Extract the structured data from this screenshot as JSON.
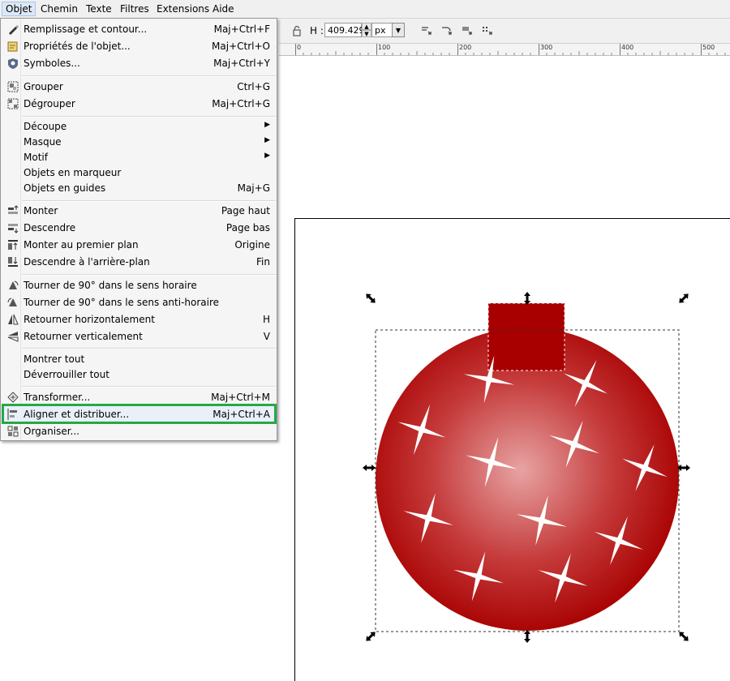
{
  "menubar": {
    "items": [
      {
        "label": "Objet",
        "active": true
      },
      {
        "label": "Chemin"
      },
      {
        "label": "Texte"
      },
      {
        "label": "Filtres"
      },
      {
        "label": "Extensions"
      },
      {
        "label": "Aide"
      }
    ]
  },
  "toolbar": {
    "h_label": "H :",
    "h_value": "409.429",
    "unit": "px",
    "spin_up": "▲",
    "spin_down": "▼",
    "dropdown_arrow": "▼"
  },
  "ruler": {
    "labels": [
      "0",
      "100",
      "200",
      "300",
      "400",
      "500"
    ]
  },
  "menu": {
    "items": [
      {
        "label": "Remplissage et contour...",
        "shortcut": "Maj+Ctrl+F",
        "icon": "fill-stroke-icon"
      },
      {
        "label": "Propriétés de l'objet...",
        "shortcut": "Maj+Ctrl+O",
        "icon": "object-properties-icon"
      },
      {
        "label": "Symboles...",
        "shortcut": "Maj+Ctrl+Y",
        "icon": "symbols-icon"
      },
      {
        "label": "Grouper",
        "shortcut": "Ctrl+G",
        "icon": "group-icon"
      },
      {
        "label": "Dégrouper",
        "shortcut": "Maj+Ctrl+G",
        "icon": "ungroup-icon"
      },
      {
        "label": "Découpe",
        "submenu": true
      },
      {
        "label": "Masque",
        "submenu": true
      },
      {
        "label": "Motif",
        "submenu": true
      },
      {
        "label": "Objets en marqueur"
      },
      {
        "label": "Objets en guides",
        "shortcut": "Maj+G"
      },
      {
        "label": "Monter",
        "shortcut": "Page haut",
        "icon": "raise-icon"
      },
      {
        "label": "Descendre",
        "shortcut": "Page bas",
        "icon": "lower-icon"
      },
      {
        "label": "Monter au premier plan",
        "shortcut": "Origine",
        "icon": "raise-to-top-icon"
      },
      {
        "label": "Descendre à l'arrière-plan",
        "shortcut": "Fin",
        "icon": "lower-to-bottom-icon"
      },
      {
        "label": "Tourner de 90° dans le sens horaire",
        "icon": "rotate-cw-icon"
      },
      {
        "label": "Tourner de 90° dans le sens anti-horaire",
        "icon": "rotate-ccw-icon"
      },
      {
        "label": "Retourner horizontalement",
        "shortcut": "H",
        "icon": "flip-horizontal-icon"
      },
      {
        "label": "Retourner verticalement",
        "shortcut": "V",
        "icon": "flip-vertical-icon"
      },
      {
        "label": "Montrer tout"
      },
      {
        "label": "Déverrouiller tout"
      },
      {
        "label": "Transformer...",
        "shortcut": "Maj+Ctrl+M",
        "icon": "transform-icon"
      },
      {
        "label": "Aligner et distribuer...",
        "shortcut": "Maj+Ctrl+A",
        "icon": "align-distribute-icon",
        "highlighted": true
      },
      {
        "label": "Organiser...",
        "icon": "arrange-icon"
      }
    ],
    "submenu_arrow": "▶"
  },
  "colors": {
    "highlight_border": "#27a845",
    "ornament_red": "#a80000",
    "ornament_center": "#e7a3a3"
  }
}
